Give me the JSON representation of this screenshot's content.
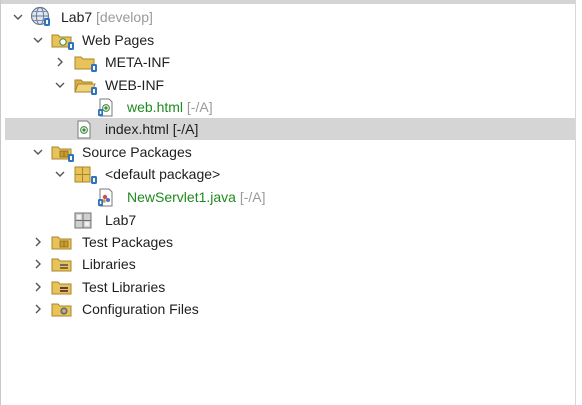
{
  "tree": {
    "project": {
      "name": "Lab7",
      "branch": "[develop]"
    },
    "web_pages": {
      "label": "Web Pages"
    },
    "meta_inf": {
      "label": "META-INF"
    },
    "web_inf": {
      "label": "WEB-INF"
    },
    "web_html": {
      "label": "web.html",
      "status": "[-/A]"
    },
    "index_html": {
      "label": "index.html",
      "status": "[-/A]"
    },
    "source_packages": {
      "label": "Source Packages"
    },
    "default_package": {
      "label": "<default package>"
    },
    "servlet": {
      "label": "NewServlet1.java",
      "status": "[-/A]"
    },
    "lab7_lib": {
      "label": "Lab7"
    },
    "test_packages": {
      "label": "Test Packages"
    },
    "libraries": {
      "label": "Libraries"
    },
    "test_libraries": {
      "label": "Test Libraries"
    },
    "configuration_files": {
      "label": "Configuration Files"
    }
  },
  "colors": {
    "selection": "#d5d5d5",
    "added_file_green": "#1f8a1f",
    "status_gray": "#9a9a9a",
    "folder_yellow": "#e8c35a",
    "badge_blue": "#2f74c0"
  }
}
